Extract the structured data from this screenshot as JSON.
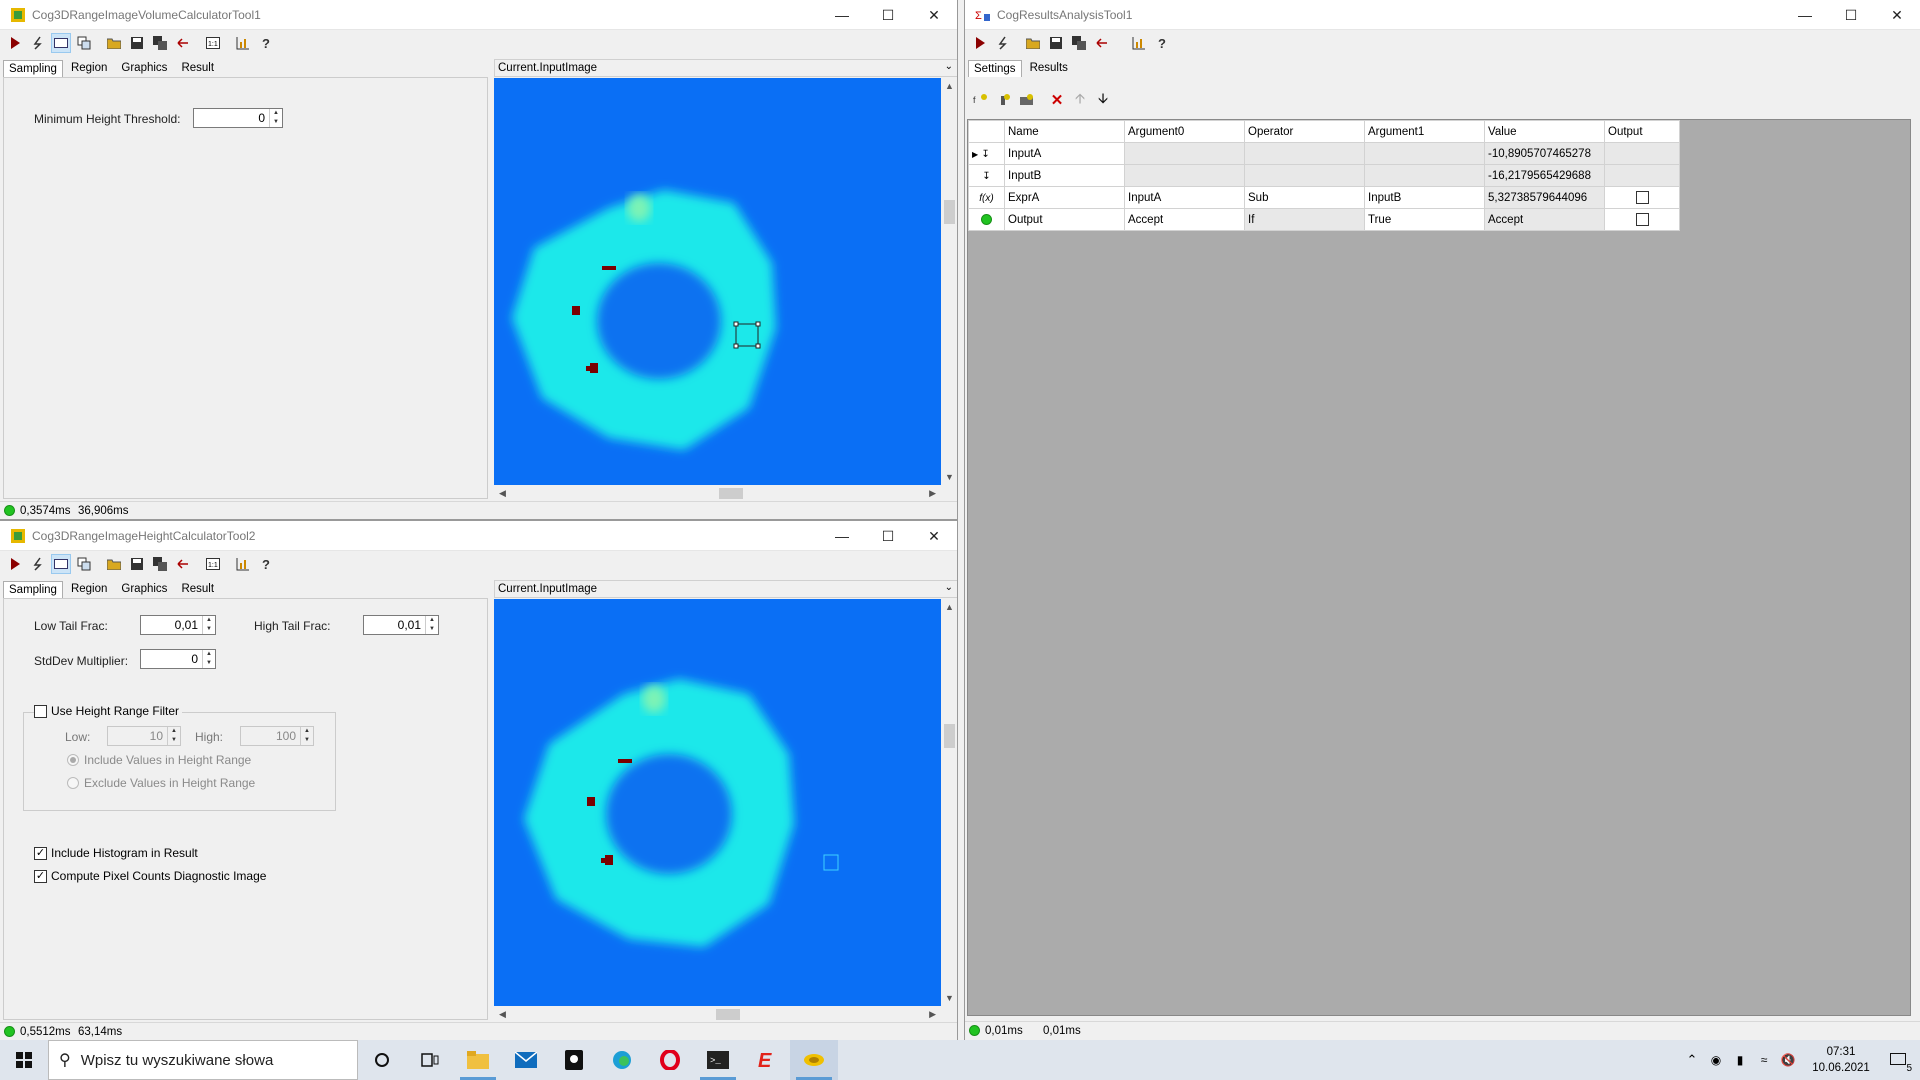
{
  "win1": {
    "title": "Cog3DRangeImageVolumeCalculatorTool1",
    "tabs": [
      "Sampling",
      "Region",
      "Graphics",
      "Result"
    ],
    "min_height_label": "Minimum Height Threshold:",
    "min_height_value": "0",
    "image_header": "Current.InputImage",
    "status_time1": "0,3574ms",
    "status_time2": "36,906ms"
  },
  "win2": {
    "title": "Cog3DRangeImageHeightCalculatorTool2",
    "tabs": [
      "Sampling",
      "Region",
      "Graphics",
      "Result"
    ],
    "low_tail_label": "Low Tail Frac:",
    "low_tail_value": "0,01",
    "high_tail_label": "High Tail Frac:",
    "high_tail_value": "0,01",
    "stddev_label": "StdDev Multiplier:",
    "stddev_value": "0",
    "use_range_label": "Use Height Range Filter",
    "low_label": "Low:",
    "low_value": "10",
    "high_label": "High:",
    "high_value": "100",
    "include_label": "Include Values in Height Range",
    "exclude_label": "Exclude Values in Height Range",
    "hist_label": "Include Histogram in Result",
    "pixcount_label": "Compute Pixel Counts Diagnostic Image",
    "image_header": "Current.InputImage",
    "status_time1": "0,5512ms",
    "status_time2": "63,14ms"
  },
  "win3": {
    "title": "CogResultsAnalysisTool1",
    "tabs": [
      "Settings",
      "Results"
    ],
    "columns": [
      "Name",
      "Argument0",
      "Operator",
      "Argument1",
      "Value",
      "Output"
    ],
    "rows": [
      {
        "name": "InputA",
        "arg0": "",
        "op": "",
        "arg1": "",
        "value": "-10,8905707465278"
      },
      {
        "name": "InputB",
        "arg0": "",
        "op": "",
        "arg1": "",
        "value": "-16,2179565429688"
      },
      {
        "name": "ExprA",
        "arg0": "InputA",
        "op": "Sub",
        "arg1": "InputB",
        "value": "5,32738579644096"
      },
      {
        "name": "Output",
        "arg0": "Accept",
        "op": "If",
        "arg1": "True",
        "value": "Accept"
      }
    ],
    "status_time1": "0,01ms",
    "status_time2": "0,01ms"
  },
  "taskbar": {
    "search_placeholder": "Wpisz tu wyszukiwane słowa",
    "time": "07:31",
    "date": "10.06.2021",
    "notif_count": "5"
  },
  "colors": {
    "image_bg": "#0a6ff5",
    "ring": "#1ee8ea",
    "status_ok": "#21c321",
    "grid_bg": "#ababab"
  }
}
